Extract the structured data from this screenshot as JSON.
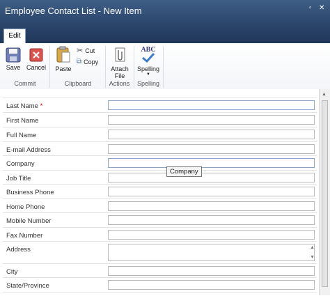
{
  "window": {
    "title": "Employee Contact List - New Item"
  },
  "ribbon": {
    "tab": "Edit",
    "save": "Save",
    "cancel": "Cancel",
    "paste": "Paste",
    "cut": "Cut",
    "copy": "Copy",
    "attach_line1": "Attach",
    "attach_line2": "File",
    "spelling_icon_text": "ABC",
    "spelling": "Spelling",
    "groups": {
      "commit": "Commit",
      "clipboard": "Clipboard",
      "actions": "Actions",
      "spelling": "Spelling"
    }
  },
  "form": {
    "required_marker": "*",
    "fields": [
      {
        "label": "Last Name",
        "value": ""
      },
      {
        "label": "First Name",
        "value": ""
      },
      {
        "label": "Full Name",
        "value": ""
      },
      {
        "label": "E-mail Address",
        "value": ""
      },
      {
        "label": "Company",
        "value": ""
      },
      {
        "label": "Job Title",
        "value": ""
      },
      {
        "label": "Business Phone",
        "value": ""
      },
      {
        "label": "Home Phone",
        "value": ""
      },
      {
        "label": "Mobile Number",
        "value": ""
      },
      {
        "label": "Fax Number",
        "value": ""
      },
      {
        "label": "Address",
        "value": ""
      },
      {
        "label": "City",
        "value": ""
      },
      {
        "label": "State/Province",
        "value": ""
      }
    ]
  },
  "tooltip": {
    "text": "Company"
  },
  "colors": {
    "titlebar": "#2a4369",
    "required": "#cc0000"
  }
}
